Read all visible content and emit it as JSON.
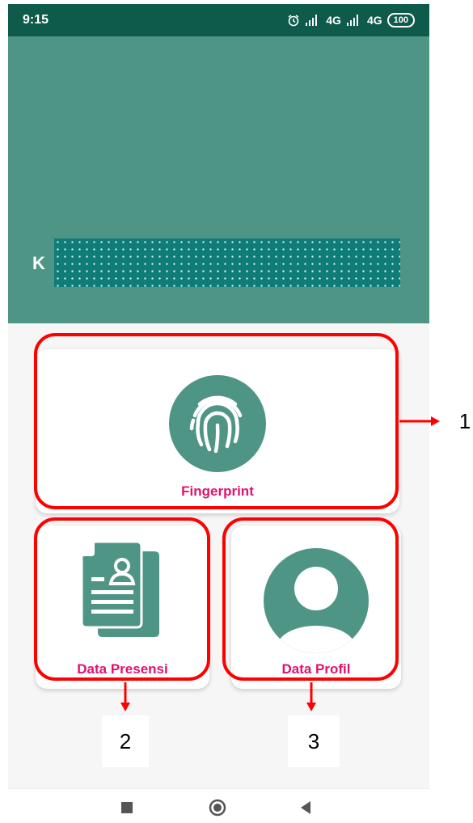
{
  "status_bar": {
    "time": "9:15",
    "network": "4G",
    "battery": "100"
  },
  "header": {
    "name_prefix": "K"
  },
  "menu": {
    "fingerprint_label": "Fingerprint",
    "presensi_label": "Data Presensi",
    "profil_label": "Data Profil"
  },
  "annotations": {
    "one": "1",
    "two": "2",
    "three": "3"
  },
  "colors": {
    "status_bar": "#0f5b4b",
    "header": "#4f9585",
    "icon": "#4f9585",
    "label": "#e0116c",
    "highlight": "#ff0000"
  },
  "icons": [
    "alarm-icon",
    "signal-icon",
    "battery-icon",
    "fingerprint-icon",
    "document-icon",
    "profile-icon",
    "square-icon",
    "circle-icon",
    "back-icon"
  ]
}
